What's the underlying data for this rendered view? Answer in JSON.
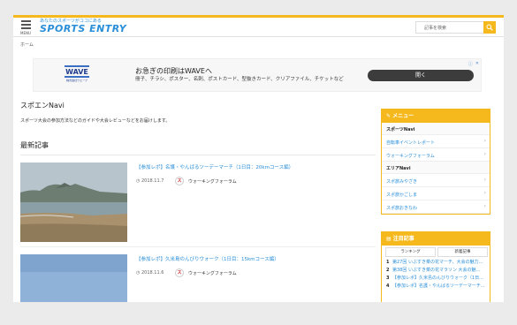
{
  "header": {
    "menu_label": "MENU",
    "tagline": "あなたのスポーツがココにある",
    "site_name": "SPORTS ENTRY",
    "search_placeholder": "記事を検索"
  },
  "breadcrumb": "ホーム",
  "ad": {
    "logo_text": "WAVE",
    "logo_sub": "株式会社ウエーブ",
    "title": "お急ぎの印刷はWAVEへ",
    "description": "冊子、チラシ、ポスター、名刺、ポストカード、型抜きカード、クリアファイル、チケットなど",
    "cta": "開く"
  },
  "main": {
    "section_title": "スポエンNavi",
    "section_desc": "スポーツ大会の参加方法などのガイドや大会レビューなどをお届けします。",
    "latest_title": "最新記事",
    "articles": [
      {
        "title": "【参加レポ】名護・やんばるツーデーマーチ（1日目：20kmコース編）",
        "date": "2018.11.7",
        "category": "ウォーキングフォーラム"
      },
      {
        "title": "【参加レポ】久米島のんびりウォーク（1日目：15kmコース編）",
        "date": "2018.11.6",
        "category": "ウォーキングフォーラム"
      }
    ]
  },
  "sidebar": {
    "menu_title": "メニュー",
    "groups": [
      {
        "label": "スポーツNavi",
        "links": [
          "自転車イベントレポート",
          "ウォーキングフォーラム"
        ]
      },
      {
        "label": "エリアNavi",
        "links": [
          "スポ旅みやざき",
          "スポ旅かごしま",
          "スポ旅おきなわ"
        ]
      }
    ],
    "popular_title": "注目記事",
    "tabs": [
      "ランキング",
      "新着記事"
    ],
    "popular_items": [
      {
        "num": "1",
        "text": "第27回 いぶすき菜の花マーチ、大会の魅力..."
      },
      {
        "num": "2",
        "text": "第38回 いぶすき菜の花マラソン 大会の魅..."
      },
      {
        "num": "3",
        "text": "【参加レポ】久米島のんびりウォーク（1日..."
      },
      {
        "num": "4",
        "text": "【参加レポ】名護・やんばるツーデーマーチ..."
      }
    ]
  },
  "colors": {
    "accent": "#f5b91e",
    "link": "#2a8fd8"
  }
}
